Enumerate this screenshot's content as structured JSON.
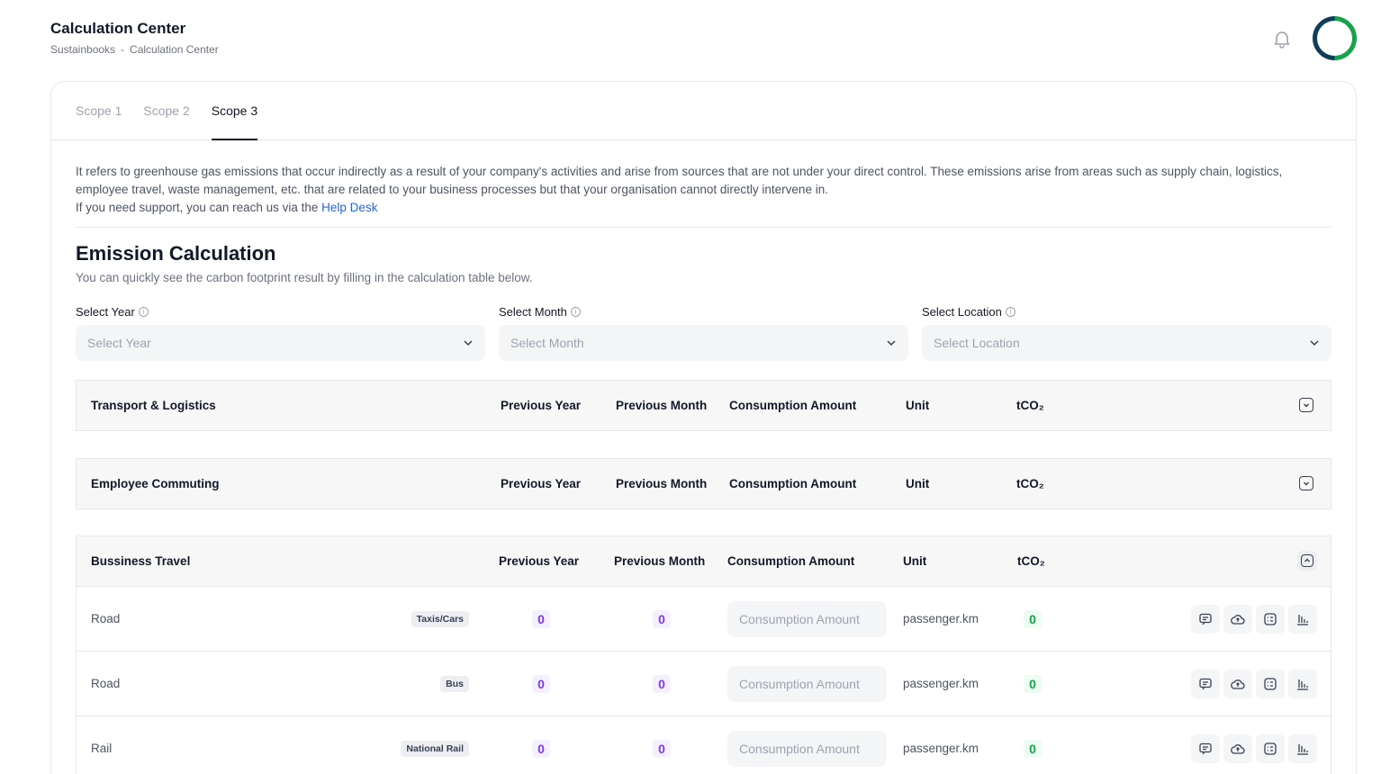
{
  "header": {
    "title": "Calculation Center",
    "breadcrumb": [
      "Sustainbooks",
      "-",
      "Calculation Center"
    ]
  },
  "tabs": [
    {
      "label": "Scope 1",
      "active": false
    },
    {
      "label": "Scope 2",
      "active": false
    },
    {
      "label": "Scope 3",
      "active": true
    }
  ],
  "description": {
    "text": "It refers to greenhouse gas emissions that occur indirectly as a result of your company's activities and arise from sources that are not under your direct control. These emissions arise from areas such as supply chain, logistics, employee travel, waste management, etc. that are related to your business processes but that your organisation cannot directly intervene in.",
    "support_prefix": "If you need support, you can reach us via the ",
    "support_link": "Help Desk"
  },
  "emission": {
    "title": "Emission Calculation",
    "subtitle": "You can quickly see the carbon footprint result by filling in the calculation table below."
  },
  "filters": {
    "year": {
      "label": "Select Year",
      "placeholder": "Select Year"
    },
    "month": {
      "label": "Select Month",
      "placeholder": "Select Month"
    },
    "location": {
      "label": "Select Location",
      "placeholder": "Select Location"
    }
  },
  "columns": {
    "prev_year": "Previous Year",
    "prev_month": "Previous Month",
    "consumption": "Consumption Amount",
    "unit": "Unit",
    "tco2": "tCO₂"
  },
  "groups": [
    {
      "title": "Transport & Logistics",
      "expanded": false
    },
    {
      "title": "Employee Commuting",
      "expanded": false
    },
    {
      "title": "Bussiness Travel",
      "expanded": true
    }
  ],
  "travel_rows": [
    {
      "name": "Road",
      "tag": "Taxis/Cars",
      "prev_year": "0",
      "prev_month": "0",
      "placeholder": "Consumption Amount",
      "unit": "passenger.km",
      "tco2": "0"
    },
    {
      "name": "Road",
      "tag": "Bus",
      "prev_year": "0",
      "prev_month": "0",
      "placeholder": "Consumption Amount",
      "unit": "passenger.km",
      "tco2": "0"
    },
    {
      "name": "Rail",
      "tag": "National Rail",
      "prev_year": "0",
      "prev_month": "0",
      "placeholder": "Consumption Amount",
      "unit": "passenger.km",
      "tco2": "0"
    }
  ],
  "icons": {
    "bell": "bell-icon",
    "info": "info-icon",
    "chevron": "chevron-down-icon",
    "actions": [
      "comment-icon",
      "upload-icon",
      "checklist-icon",
      "chart-icon"
    ]
  }
}
